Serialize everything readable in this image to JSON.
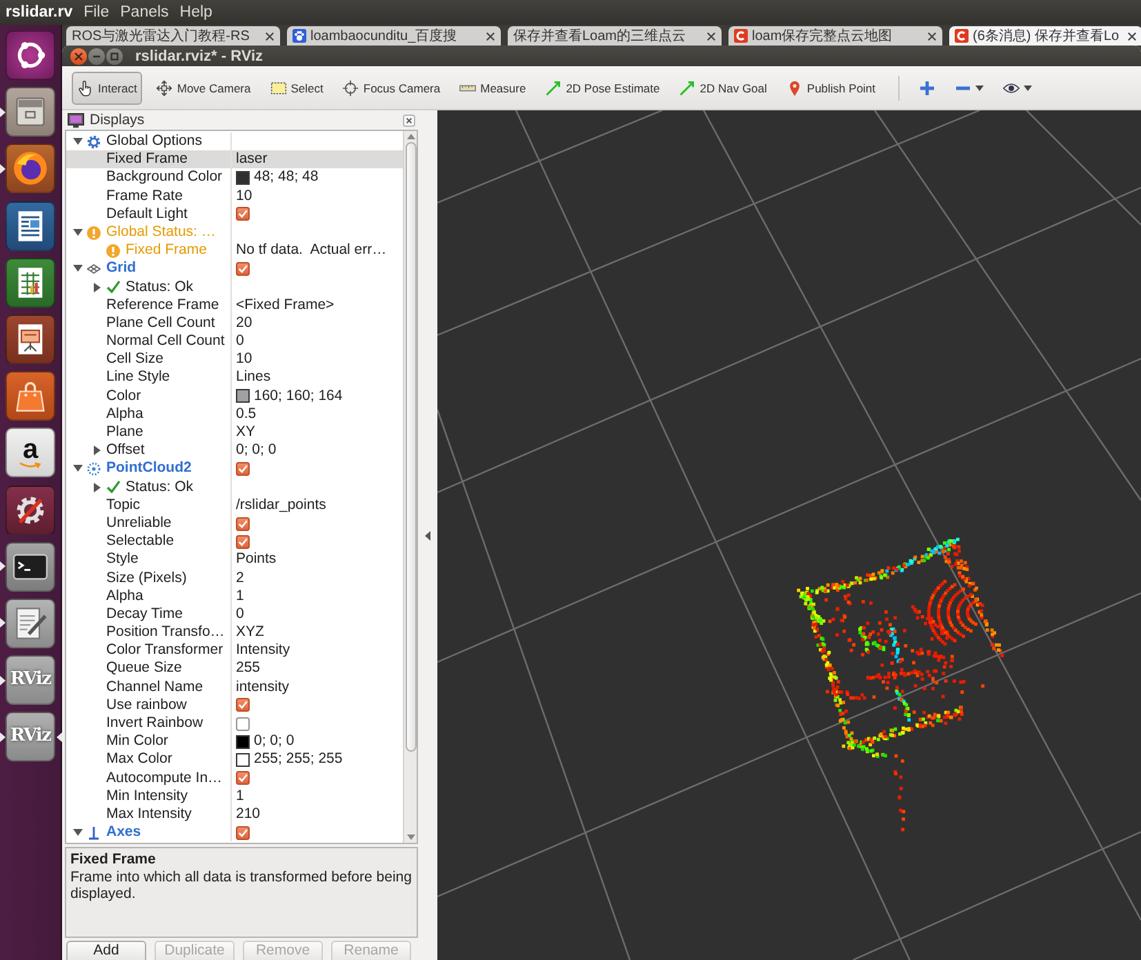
{
  "top_panel": {
    "app_title": "rslidar.rv",
    "menus": [
      "File",
      "Panels",
      "Help"
    ]
  },
  "launcher": [
    {
      "kind": "home",
      "running": false,
      "selected": false
    },
    {
      "kind": "files",
      "running": true,
      "selected": false
    },
    {
      "kind": "browser",
      "running": true,
      "selected": false
    },
    {
      "kind": "writer",
      "running": false,
      "selected": false
    },
    {
      "kind": "calc",
      "running": false,
      "selected": false
    },
    {
      "kind": "impress",
      "running": false,
      "selected": false
    },
    {
      "kind": "store",
      "running": false,
      "selected": false
    },
    {
      "kind": "amazon",
      "label": "a",
      "running": false,
      "selected": false
    },
    {
      "kind": "settings",
      "running": false,
      "selected": false
    },
    {
      "kind": "terminal",
      "running": true,
      "selected": false
    },
    {
      "kind": "editor",
      "running": true,
      "selected": false
    },
    {
      "kind": "rviz",
      "label": "RViz",
      "running": true,
      "selected": false
    },
    {
      "kind": "rviz",
      "label": "RViz",
      "running": true,
      "selected": true
    }
  ],
  "browser_tabs": [
    {
      "kind": "page",
      "title": "ROS与激光雷达入门教程-RS",
      "selected": false
    },
    {
      "kind": "search",
      "title": "loambaocunditu_百度搜",
      "selected": false
    },
    {
      "kind": "page",
      "title": "保存并查看Loam的三维点云",
      "selected": false
    },
    {
      "kind": "blog",
      "title": "loam保存完整点云地图",
      "selected": false
    },
    {
      "kind": "blog",
      "title": "(6条消息) 保存并查看Lo",
      "selected": true
    }
  ],
  "window": {
    "title": "rslidar.rviz* - RViz"
  },
  "toolbar": [
    {
      "kind": "interact",
      "label": "Interact",
      "selected": true
    },
    {
      "kind": "move-camera",
      "label": "Move Camera",
      "selected": false
    },
    {
      "kind": "select",
      "label": "Select",
      "selected": false
    },
    {
      "kind": "focus-camera",
      "label": "Focus Camera",
      "selected": false
    },
    {
      "kind": "measure",
      "label": "Measure",
      "selected": false
    },
    {
      "kind": "pose-estimate",
      "label": "2D Pose Estimate",
      "selected": false
    },
    {
      "kind": "nav-goal",
      "label": "2D Nav Goal",
      "selected": false
    },
    {
      "kind": "publish-point",
      "label": "Publish Point",
      "selected": false
    }
  ],
  "displays": {
    "title": "Displays",
    "tree": [
      {
        "label": "Global Options",
        "kind": "options",
        "selected": false,
        "expanded": true,
        "children": [
          {
            "label": "Fixed Frame",
            "value": "laser",
            "kind": "property",
            "selected": true
          },
          {
            "label": "Background Color",
            "value": "48; 48; 48",
            "color": "#303030",
            "kind": "property",
            "selected": false
          },
          {
            "label": "Frame Rate",
            "value": "10",
            "kind": "property",
            "selected": false
          },
          {
            "label": "Default Light",
            "checked": true,
            "kind": "property",
            "selected": false
          }
        ]
      },
      {
        "label": "Global Status: …",
        "kind": "status",
        "warning": true,
        "selected": false,
        "expanded": true,
        "children": [
          {
            "label": "Fixed Frame",
            "value": "No tf data.  Actual err…",
            "kind": "status",
            "warning": true,
            "selected": false
          }
        ]
      },
      {
        "label": "Grid",
        "kind": "grid",
        "checked": true,
        "selected": false,
        "expanded": true,
        "children": [
          {
            "label": "Status: Ok",
            "kind": "status",
            "warning": false,
            "expanded": false,
            "selected": false
          },
          {
            "label": "Reference Frame",
            "value": "<Fixed Frame>",
            "kind": "property",
            "selected": false
          },
          {
            "label": "Plane Cell Count",
            "value": "20",
            "kind": "property",
            "selected": false
          },
          {
            "label": "Normal Cell Count",
            "value": "0",
            "kind": "property",
            "selected": false
          },
          {
            "label": "Cell Size",
            "value": "10",
            "kind": "property",
            "selected": false
          },
          {
            "label": "Line Style",
            "value": "Lines",
            "kind": "property",
            "selected": false
          },
          {
            "label": "Color",
            "value": "160; 160; 164",
            "color": "#a0a0a4",
            "kind": "property",
            "selected": false
          },
          {
            "label": "Alpha",
            "value": "0.5",
            "kind": "property",
            "selected": false
          },
          {
            "label": "Plane",
            "value": "XY",
            "kind": "property",
            "selected": false
          },
          {
            "label": "Offset",
            "value": "0; 0; 0",
            "kind": "property",
            "expanded": false,
            "selected": false
          }
        ]
      },
      {
        "label": "PointCloud2",
        "kind": "cloud",
        "checked": true,
        "selected": false,
        "expanded": true,
        "children": [
          {
            "label": "Status: Ok",
            "kind": "status",
            "warning": false,
            "expanded": false,
            "selected": false
          },
          {
            "label": "Topic",
            "value": "/rslidar_points",
            "kind": "property",
            "selected": false
          },
          {
            "label": "Unreliable",
            "checked": true,
            "kind": "property",
            "selected": false
          },
          {
            "label": "Selectable",
            "checked": true,
            "kind": "property",
            "selected": false
          },
          {
            "label": "Style",
            "value": "Points",
            "kind": "property",
            "selected": false
          },
          {
            "label": "Size (Pixels)",
            "value": "2",
            "kind": "property",
            "selected": false
          },
          {
            "label": "Alpha",
            "value": "1",
            "kind": "property",
            "selected": false
          },
          {
            "label": "Decay Time",
            "value": "0",
            "kind": "property",
            "selected": false
          },
          {
            "label": "Position Transfo…",
            "value": "XYZ",
            "kind": "property",
            "selected": false
          },
          {
            "label": "Color Transformer",
            "value": "Intensity",
            "kind": "property",
            "selected": false
          },
          {
            "label": "Queue Size",
            "value": "255",
            "kind": "property",
            "selected": false
          },
          {
            "label": "Channel Name",
            "value": "intensity",
            "kind": "property",
            "selected": false
          },
          {
            "label": "Use rainbow",
            "checked": true,
            "kind": "property",
            "selected": false
          },
          {
            "label": "Invert Rainbow",
            "checked": false,
            "kind": "property",
            "selected": false
          },
          {
            "label": "Min Color",
            "value": "0; 0; 0",
            "color": "#000000",
            "kind": "property",
            "selected": false
          },
          {
            "label": "Max Color",
            "value": "255; 255; 255",
            "color": "#ffffff",
            "kind": "property",
            "selected": false
          },
          {
            "label": "Autocompute In…",
            "checked": true,
            "kind": "property",
            "selected": false
          },
          {
            "label": "Min Intensity",
            "value": "1",
            "kind": "property",
            "selected": false
          },
          {
            "label": "Max Intensity",
            "value": "210",
            "kind": "property",
            "selected": false
          }
        ]
      },
      {
        "label": "Axes",
        "kind": "axes",
        "checked": true,
        "selected": false,
        "expanded": true
      }
    ],
    "description": {
      "title": "Fixed Frame",
      "text": "Frame into which all data is transformed before being displayed."
    },
    "buttons": [
      {
        "label": "Add",
        "disabled": false
      },
      {
        "label": "Duplicate",
        "disabled": true
      },
      {
        "label": "Remove",
        "disabled": true
      },
      {
        "label": "Rename",
        "disabled": true
      }
    ]
  }
}
